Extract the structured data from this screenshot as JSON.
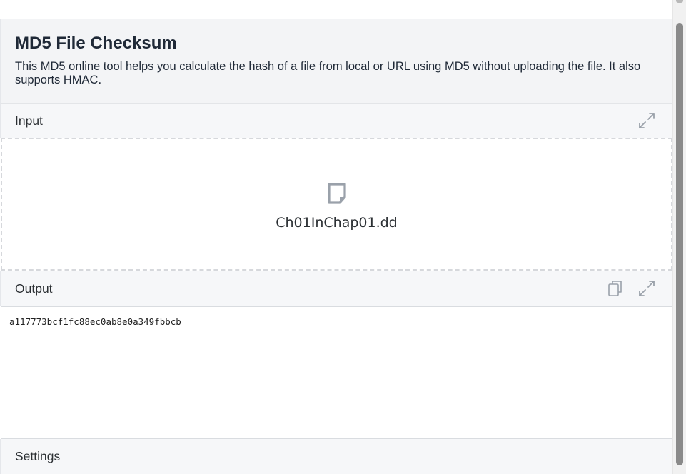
{
  "header": {
    "title": "MD5 File Checksum",
    "description": "This MD5 online tool helps you calculate the hash of a file from local or URL using MD5 without uploading the file. It also supports HMAC."
  },
  "input": {
    "label": "Input",
    "file_name": "Ch01InChap01.dd",
    "icons": [
      "expand-icon",
      "file-icon"
    ]
  },
  "output": {
    "label": "Output",
    "value": "a117773bcf1fc88ec0ab8e0a349fbbcb",
    "icons": [
      "copy-icon",
      "expand-icon"
    ]
  },
  "settings": {
    "label": "Settings"
  },
  "colors": {
    "header_bg": "#f3f4f6",
    "bar_bg": "#f6f7f9",
    "icon_gray": "#9aa1aa"
  }
}
